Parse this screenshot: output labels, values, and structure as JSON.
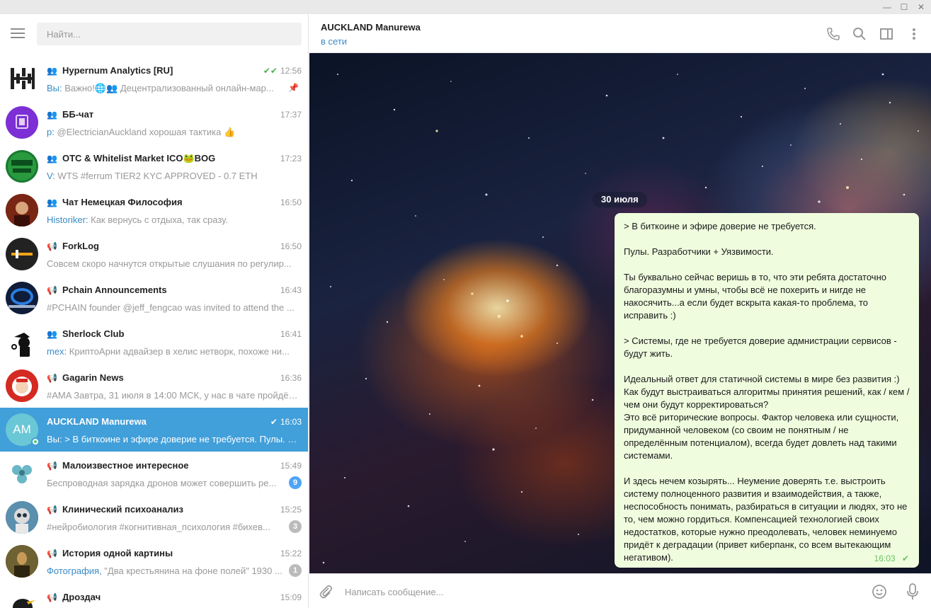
{
  "window": {
    "minimize": "—",
    "maximize": "☐",
    "close": "✕"
  },
  "search": {
    "placeholder": "Найти..."
  },
  "chats": [
    {
      "title": "Hypernum Analytics [RU]",
      "time": "12:56",
      "sender": "Вы:",
      "preview": " Важно!🌐👥 Децентрализованный онлайн-мар...",
      "kind": "group",
      "read": "double",
      "pinned": true,
      "avatar_label": ""
    },
    {
      "title": "ББ-чат",
      "time": "17:37",
      "sender": "p:",
      "preview": " @ElectricianAuckland хорошая тактика 👍",
      "kind": "group",
      "avatar_label": ""
    },
    {
      "title": "OTC & Whitelist Market ICO🐸BOG",
      "time": "17:23",
      "sender": "V:",
      "preview": " WTS #ferrum TIER2 KYC APPROVED - 0.7 ETH",
      "kind": "group",
      "avatar_label": ""
    },
    {
      "title": "Чат Немецкая Философия",
      "time": "16:50",
      "sender": "Historiker:",
      "preview": " Как вернусь с отдыха, так сразу.",
      "kind": "group",
      "avatar_label": ""
    },
    {
      "title": "ForkLog",
      "time": "16:50",
      "sender": "",
      "preview": "Совсем скоро начнутся открытые слушания по регулир...",
      "kind": "channel",
      "avatar_label": ""
    },
    {
      "title": "Pchain Announcements",
      "time": "16:43",
      "sender": "",
      "preview": "#PCHAIN founder @jeff_fengcao was invited to attend the ...",
      "kind": "channel",
      "avatar_label": ""
    },
    {
      "title": "Sherlock Club",
      "time": "16:41",
      "sender": "mex:",
      "preview": " КриптоАрни адвайзер в хелис нетворк, похоже ни...",
      "kind": "group",
      "avatar_label": ""
    },
    {
      "title": "Gagarin News",
      "time": "16:36",
      "sender": "",
      "preview": "#AMA Завтра, 31 июля в 14:00 МСК, у нас в чате пройдёт ...",
      "kind": "channel",
      "avatar_label": ""
    },
    {
      "title": "AUCKLAND Manurewa",
      "time": "16:03",
      "sender": "Вы:",
      "preview": " > В биткоине и эфире доверие не требуется.  Пулы. Р...",
      "kind": "user",
      "read": "single",
      "active": true,
      "online": true,
      "avatar_label": "AM"
    },
    {
      "title": "Малоизвестное интересное",
      "time": "15:49",
      "sender": "",
      "preview": "Беспроводная зарядка дронов может совершить ре...",
      "kind": "channel",
      "unread": "9",
      "unread_style": "blue",
      "avatar_label": ""
    },
    {
      "title": "Клинический психоанализ",
      "time": "15:25",
      "sender": "",
      "preview": "#нейробиология #когнитивная_психология #бихев...",
      "kind": "channel",
      "unread": "3",
      "unread_style": "grey",
      "avatar_label": ""
    },
    {
      "title": "История одной картины",
      "time": "15:22",
      "sender": "Фотография,",
      "preview": " \"Два крестьянина на фоне полей\" 1930 ...",
      "kind": "channel",
      "unread": "1",
      "unread_style": "grey",
      "avatar_label": ""
    },
    {
      "title": "Дроздач",
      "time": "15:09",
      "sender": "",
      "preview": "",
      "kind": "channel",
      "avatar_label": ""
    }
  ],
  "peer": {
    "name": "AUCKLAND Manurewa",
    "status": "в сети"
  },
  "conversation": {
    "date": "30 июля",
    "message": {
      "text": "> В биткоине и эфире доверие не требуется.\n\nПулы. Разработчики + Уязвимости.\n\nТы буквально сейчас веришь в то, что эти ребята достаточно благоразумны и умны, чтобы всё не похерить и нигде не накосячить...а если будет вскрыта какая-то проблема, то исправить :)\n\n> Системы, где не требуется доверие адмнистрации сервисов - будут жить.\n\nИдеальный ответ для статичной системы в мире без развития :)\nКак будут выстраиваться алгоритмы принятия решений, как / кем / чем они будут корректироваться?\nЭто всё риторические вопросы. Фактор человека или сущности, придуманной человеком (со своим не понятным / не определённым потенциалом), всегда будет довлеть над такими системами.\n\nИ здесь нечем козырять... Неумение доверять т.е. выстроить систему полноценного развития и взаимодействия, а также, неспособность понимать, разбираться в ситуации и людях, это не то, чем можно гордиться. Компенсацией технологией своих недостатков, которые нужно преодолевать, человек неминуемо придёт к деградации (привет киберпанк, со всем вытекающим негативом).",
      "time": "16:03",
      "status_icon": "check-icon"
    }
  },
  "composer": {
    "placeholder": "Написать сообщение..."
  },
  "colors": {
    "accent": "#419fd9",
    "outgoing_bubble": "#effdde",
    "read_check": "#4fae4e",
    "link": "#3a8bc6"
  }
}
